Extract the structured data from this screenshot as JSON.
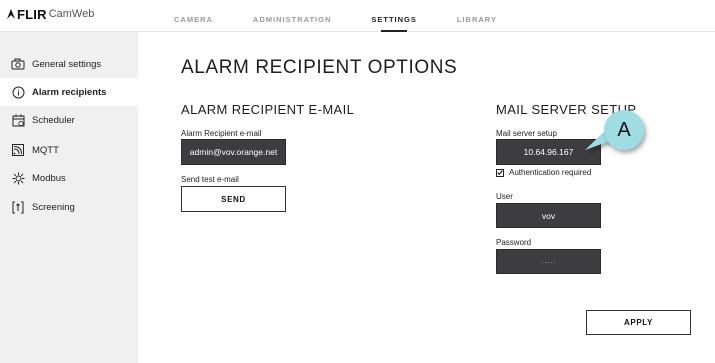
{
  "header": {
    "brand": "FLIR",
    "product": "CamWeb",
    "tabs": [
      {
        "label": "CAMERA",
        "active": false
      },
      {
        "label": "ADMINISTRATION",
        "active": false
      },
      {
        "label": "SETTINGS",
        "active": true
      },
      {
        "label": "LIBRARY",
        "active": false
      }
    ]
  },
  "sidebar": {
    "items": [
      {
        "label": "General settings",
        "icon": "camera-icon",
        "active": false
      },
      {
        "label": "Alarm recipients",
        "icon": "info-icon",
        "active": true
      },
      {
        "label": "Scheduler",
        "icon": "calendar-icon",
        "active": false
      },
      {
        "label": "MQTT",
        "icon": "mqtt-icon",
        "active": false
      },
      {
        "label": "Modbus",
        "icon": "modbus-icon",
        "active": false
      },
      {
        "label": "Screening",
        "icon": "screening-icon",
        "active": false
      }
    ]
  },
  "main": {
    "page_title": "ALARM RECIPIENT OPTIONS",
    "email_section": {
      "title": "ALARM RECIPIENT E-MAIL",
      "email_label": "Alarm Recipient e-mail",
      "email_value": "admin@vov.orange.net",
      "test_label": "Send test e-mail",
      "send_button": "SEND"
    },
    "mail_server_section": {
      "title": "MAIL SERVER SETUP",
      "server_label": "Mail server setup",
      "server_value": "10.64.96.167",
      "auth_label": "Authentication required",
      "auth_checked": true,
      "user_label": "User",
      "user_value": "vov",
      "password_label": "Password",
      "password_value": "·····"
    },
    "apply_button": "APPLY"
  },
  "callout": {
    "label": "A",
    "color": "#9fdde4"
  }
}
